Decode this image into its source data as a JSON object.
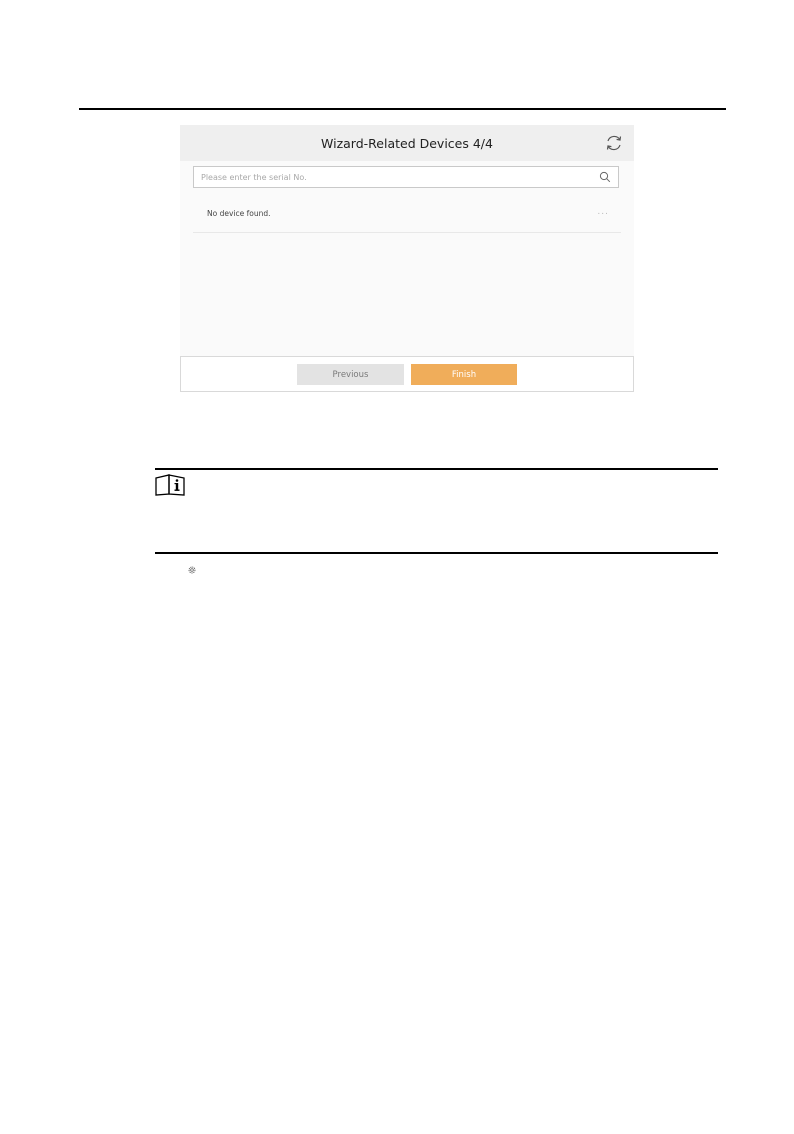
{
  "wizard": {
    "title": "Wizard-Related Devices 4/4",
    "search": {
      "placeholder": "Please enter the serial No.",
      "value": ""
    },
    "empty_message": "No device found.",
    "more_indicator": "...",
    "buttons": {
      "previous": "Previous",
      "finish": "Finish"
    },
    "colors": {
      "finish_bg": "#f0ad5a",
      "previous_bg": "#e3e3e3",
      "header_bg": "#efefef"
    }
  },
  "icons": {
    "refresh": "refresh-icon",
    "search": "search-icon",
    "note": "note-book-info-icon",
    "settings": "gear-icon"
  }
}
